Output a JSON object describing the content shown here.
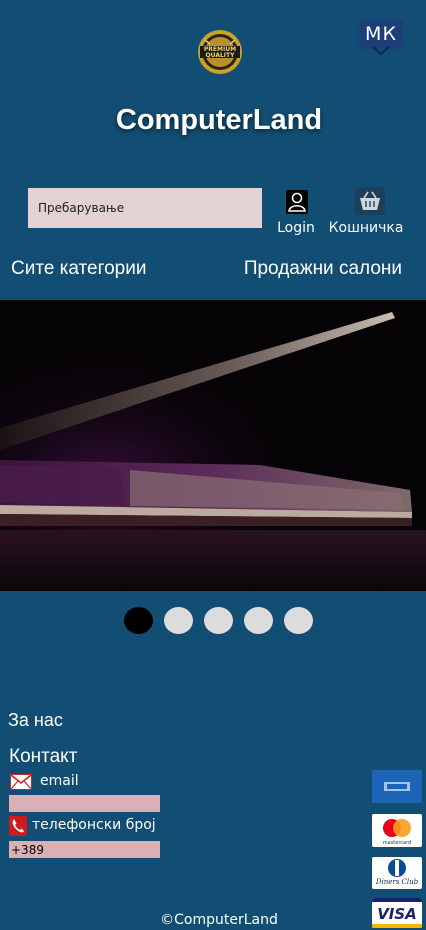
{
  "header": {
    "language": "МК",
    "brand": "ComputerLand",
    "seal_text": [
      "PREMIUM",
      "QUALITY"
    ]
  },
  "search": {
    "placeholder": "Пребарување"
  },
  "toolbar": {
    "login_label": "Login",
    "cart_label": "Кошничка"
  },
  "nav": {
    "all_categories": "Сите категории",
    "stores": "Продажни салони"
  },
  "carousel": {
    "slides": 5,
    "active_index": 0
  },
  "footer_links": {
    "about": "За нас",
    "contact": "Контакт"
  },
  "contact": {
    "email_label": "email",
    "email_value": "",
    "phone_label": "телефонски број",
    "phone_value": "+389"
  },
  "payment_cards": [
    "amex-card-icon",
    "mastercard-icon",
    "diners-club-icon",
    "visa-icon"
  ],
  "cards_text": {
    "mastercard": "mastercard",
    "diners": "Diners Club",
    "visa": "VISA"
  },
  "copyright": "©ComputerLand",
  "colors": {
    "background": "#124e73",
    "field": "#dab0b4",
    "search_bg": "#e2d2d4"
  }
}
